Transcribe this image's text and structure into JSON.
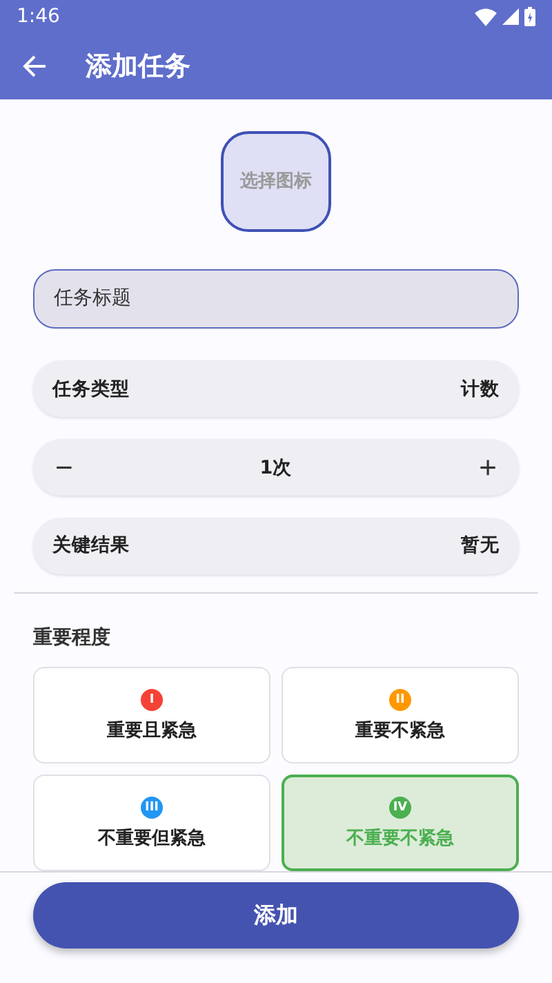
{
  "status_bar": {
    "time": "1:46"
  },
  "app_bar": {
    "title": "添加任务"
  },
  "icon_picker": {
    "label": "选择图标"
  },
  "title_field": {
    "placeholder": "任务标题"
  },
  "task_type": {
    "label": "任务类型",
    "value": "计数"
  },
  "counter": {
    "minus": "−",
    "value": "1次",
    "plus": "+"
  },
  "key_result": {
    "label": "关键结果",
    "value": "暂无"
  },
  "importance": {
    "heading": "重要程度",
    "options": [
      {
        "badge": "I",
        "label": "重要且紧急",
        "color": "#f44336",
        "selected": false
      },
      {
        "badge": "II",
        "label": "重要不紧急",
        "color": "#ff9800",
        "selected": false
      },
      {
        "badge": "III",
        "label": "不重要但紧急",
        "color": "#2196f3",
        "selected": false
      },
      {
        "badge": "IV",
        "label": "不重要不紧急",
        "color": "#4caf50",
        "selected": true
      }
    ]
  },
  "submit": {
    "label": "添加"
  }
}
